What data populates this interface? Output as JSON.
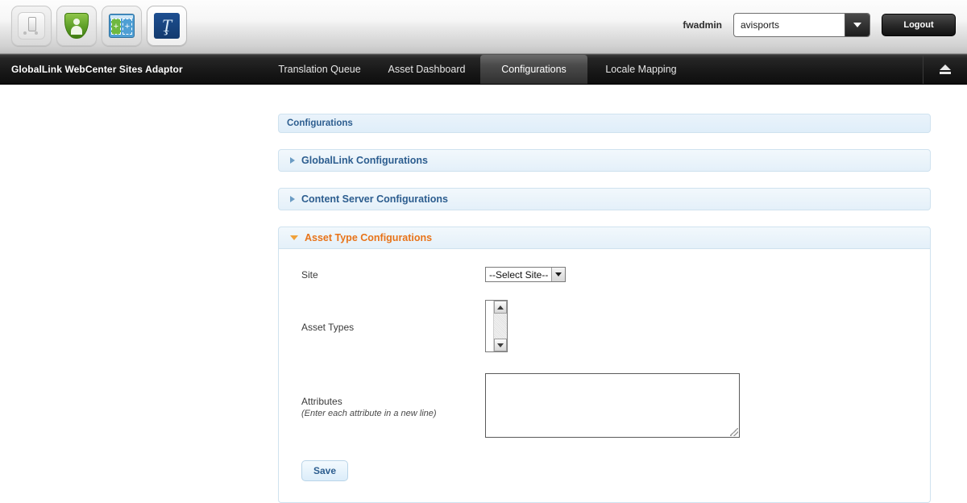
{
  "toolbar": {
    "icons": [
      {
        "name": "document-icon",
        "label": "Document"
      },
      {
        "name": "shield-user-icon",
        "label": "Security"
      },
      {
        "name": "panes-add-icon",
        "label": "Add Panes"
      },
      {
        "name": "globallink-brand-icon",
        "label": "GlobalLink",
        "glyph": "Ţ"
      }
    ],
    "user": "fwadmin",
    "site_value": "avisports",
    "logout_label": "Logout"
  },
  "nav": {
    "brand": "GlobalLink WebCenter Sites Adaptor",
    "tabs": [
      {
        "label": "Translation Queue",
        "active": false
      },
      {
        "label": "Asset Dashboard",
        "active": false
      },
      {
        "label": "Configurations",
        "active": true
      },
      {
        "label": "Locale Mapping",
        "active": false
      }
    ],
    "eject_icon": "eject-icon"
  },
  "page": {
    "title": "Configurations",
    "sections": [
      {
        "title": "GlobalLink Configurations",
        "open": false
      },
      {
        "title": "Content Server Configurations",
        "open": false
      },
      {
        "title": "Asset Type Configurations",
        "open": true
      }
    ]
  },
  "form": {
    "site": {
      "label": "Site",
      "value": "--Select Site--"
    },
    "asset_types": {
      "label": "Asset Types",
      "value": ""
    },
    "attributes": {
      "label": "Attributes",
      "hint": "(Enter each attribute in a new line)",
      "value": "",
      "placeholder": ""
    },
    "save_label": "Save"
  },
  "colors": {
    "accent_blue": "#2c5d8f",
    "accent_orange": "#e8741a",
    "panel_border": "#cfe2ef",
    "nav_background": "#171717"
  }
}
